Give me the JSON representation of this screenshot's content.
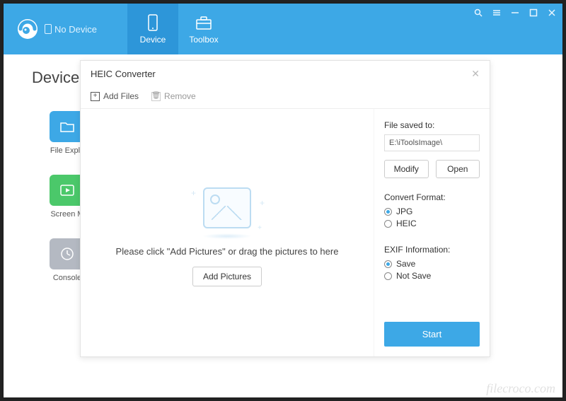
{
  "header": {
    "device_status": "No Device",
    "tabs": {
      "device": "Device",
      "toolbox": "Toolbox"
    }
  },
  "page": {
    "title": "Device"
  },
  "tools": {
    "file_explorer": "File Explo",
    "screen_mirror": "Screen M",
    "console": "Console"
  },
  "dialog": {
    "title": "HEIC Converter",
    "toolbar": {
      "add_files": "Add Files",
      "remove": "Remove"
    },
    "drop": {
      "hint": "Please click \"Add Pictures\" or drag the pictures to here",
      "button": "Add Pictures"
    },
    "side": {
      "saved_to_label": "File saved to:",
      "saved_to_path": "E:\\iToolsImage\\",
      "modify": "Modify",
      "open": "Open",
      "convert_format_label": "Convert Format:",
      "format_options": {
        "jpg": "JPG",
        "heic": "HEIC"
      },
      "exif_label": "EXIF Information:",
      "exif_options": {
        "save": "Save",
        "not_save": "Not Save"
      },
      "start": "Start"
    }
  },
  "watermark": "filecroco.com"
}
